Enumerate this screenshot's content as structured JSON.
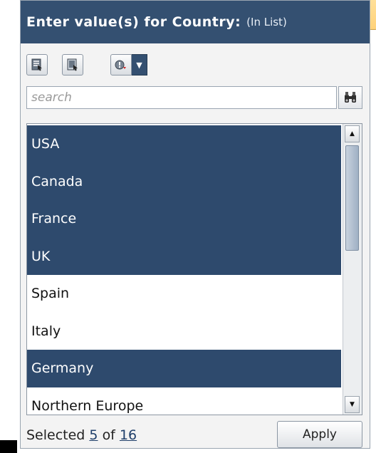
{
  "dialog": {
    "title": "Enter value(s) for Country:",
    "subtitle": "(In List)"
  },
  "toolbar": {
    "buttons": [
      {
        "icon": "select-all-icon"
      },
      {
        "icon": "deselect-all-icon"
      }
    ],
    "mode_icon": "info-icon",
    "mode_caret_icon": "caret-down-icon"
  },
  "search": {
    "placeholder": "search",
    "value": "",
    "button_icon": "binoculars-icon"
  },
  "list": {
    "items": [
      {
        "label": "USA",
        "selected": true
      },
      {
        "label": "Canada",
        "selected": true
      },
      {
        "label": "France",
        "selected": true
      },
      {
        "label": "UK",
        "selected": true
      },
      {
        "label": "Spain",
        "selected": false
      },
      {
        "label": "Italy",
        "selected": false
      },
      {
        "label": "Germany",
        "selected": true
      },
      {
        "label": "Northern Europe",
        "selected": false
      }
    ],
    "scroll_position": 0.0
  },
  "footer": {
    "selected_prefix": "Selected",
    "selected_count": "5",
    "of_text": "of",
    "total_count": "16",
    "apply_label": "Apply"
  },
  "colors": {
    "header_bg": "#345071",
    "selected_bg": "#2e4a6d",
    "panel_bg": "#f3f3f3"
  }
}
